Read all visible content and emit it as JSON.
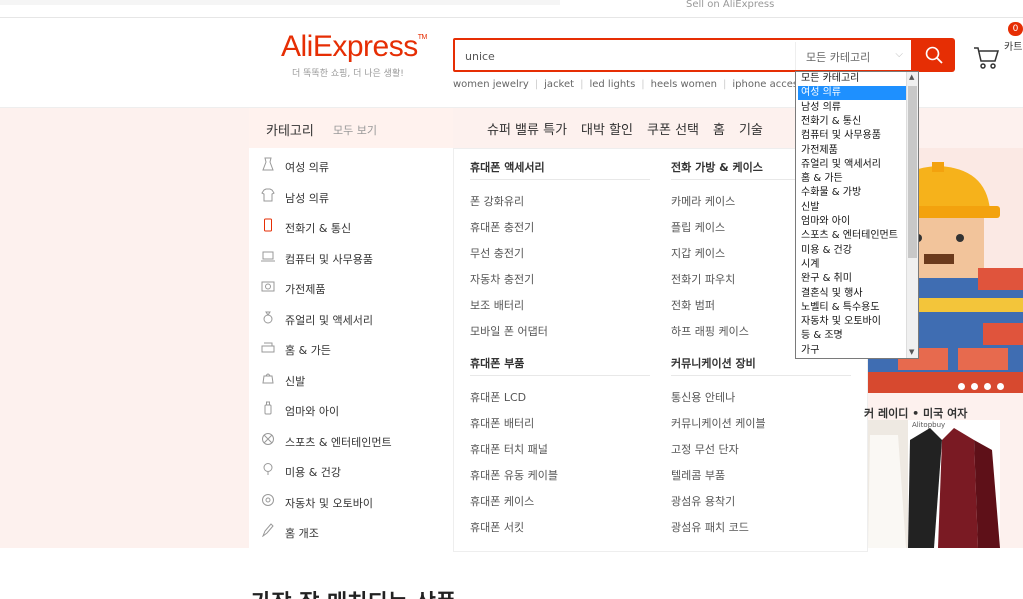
{
  "topbar": {
    "sell": "Sell on AliExpress"
  },
  "header": {
    "logo_main": "AliExpress",
    "logo_tm": "TM",
    "slogan": "더 똑똑한 쇼핑, 더 나은 생활!",
    "search_value": "unice",
    "category_select": "모든 카테고리",
    "hot_searches": [
      "women jewelry",
      "jacket",
      "led lights",
      "heels women",
      "iphone accesso"
    ],
    "cart_count": "0",
    "cart_label": "카트"
  },
  "catbar": {
    "title": "카테고리",
    "all": "모두 보기"
  },
  "nav": [
    "슈퍼 밸류 특가",
    "대박 할인",
    "쿠폰 선택",
    "홈",
    "기술"
  ],
  "categories": [
    {
      "label": "여성 의류",
      "icon": "dress-icon"
    },
    {
      "label": "남성 의류",
      "icon": "shirt-icon"
    },
    {
      "label": "전화기 & 통신",
      "icon": "phone-icon"
    },
    {
      "label": "컴퓨터 및 사무용품",
      "icon": "laptop-icon"
    },
    {
      "label": "가전제품",
      "icon": "camera-icon"
    },
    {
      "label": "쥬얼리 및 액세서리",
      "icon": "ring-icon"
    },
    {
      "label": "홈 & 가든",
      "icon": "sofa-icon"
    },
    {
      "label": "신발",
      "icon": "bag-icon"
    },
    {
      "label": "엄마와 아이",
      "icon": "bottle-icon"
    },
    {
      "label": "스포츠 & 엔터테인먼트",
      "icon": "ball-icon"
    },
    {
      "label": "미용 & 건강",
      "icon": "lightbulb-icon"
    },
    {
      "label": "자동차 및 오토바이",
      "icon": "wheel-icon"
    },
    {
      "label": "홈 개조",
      "icon": "brush-icon"
    }
  ],
  "mega": {
    "col1": [
      {
        "head": "휴대폰 액세서리",
        "items": [
          "폰 강화유리",
          "휴대폰 충전기",
          "무선 충전기",
          "자동차 충전기",
          "보조 배터리",
          "모바일 폰 어댑터"
        ]
      },
      {
        "head": "휴대폰 부품",
        "items": [
          "휴대폰 LCD",
          "휴대폰 배터리",
          "휴대폰 터치 패널",
          "휴대폰 유동 케이블",
          "휴대폰 케이스",
          "휴대폰 서킷"
        ]
      }
    ],
    "col2": [
      {
        "head": "전화 가방 & 케이스",
        "items": [
          "카메라 케이스",
          "플립 케이스",
          "지갑 케이스",
          "전화기 파우치",
          "전화 범퍼",
          "하프 래핑 케이스"
        ]
      },
      {
        "head": "커뮤니케이션 장비",
        "items": [
          "통신용 안테나",
          "커뮤니케이션 케이블",
          "고정 무선 단자",
          "텔레콤 부품",
          "광섬유 용착기",
          "광섬유 패치 코드"
        ]
      }
    ]
  },
  "promo": {
    "title": "커 레이디 • 미국 여자",
    "img_label": "Alitopbuy"
  },
  "bottom_title": "가장 잘 매치되는 상품",
  "dropdown": {
    "options": [
      "모든 카테고리",
      "여성 의류",
      "남성 의류",
      "전화기 & 통신",
      "컴퓨터 및 사무용품",
      "가전제품",
      "쥬얼리 및 액세서리",
      "홈 & 가든",
      "수화물 & 가방",
      "신발",
      "엄마와 아이",
      "스포츠 & 엔터테인먼트",
      "미용 & 건강",
      "시계",
      "완구 & 취미",
      "결혼식 및 행사",
      "노벨티 & 특수용도",
      "자동차 및 오토바이",
      "등 & 조명",
      "가구"
    ],
    "selected_index": 1
  },
  "colors": {
    "accent": "#e62e04",
    "band": "#fdf1ee",
    "select": "#1e90ff"
  }
}
